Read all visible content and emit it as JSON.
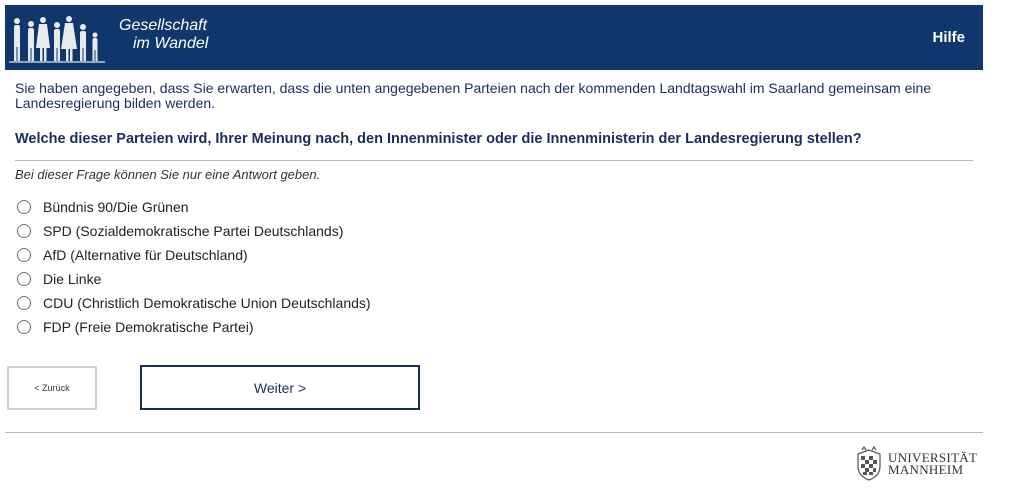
{
  "header": {
    "logo_line1": "Gesellschaft",
    "logo_line2": "im Wandel",
    "help_label": "Hilfe",
    "background_color": "#10376b"
  },
  "intro_text": "Sie haben angegeben, dass Sie erwarten, dass die unten angegebenen Parteien nach der kommenden Landtagswahl im Saarland gemeinsam eine Landesregierung bilden werden.",
  "question": "Welche dieser Parteien wird, Ihrer Meinung nach, den Innenminister oder die Innenministerin der Landesregierung stellen?",
  "instruction": "Bei dieser Frage können Sie nur eine Antwort geben.",
  "options": [
    {
      "label": "Bündnis 90/Die Grünen",
      "selected": false
    },
    {
      "label": "SPD (Sozialdemokratische Partei Deutschlands)",
      "selected": false
    },
    {
      "label": "AfD (Alternative für Deutschland)",
      "selected": false
    },
    {
      "label": "Die Linke",
      "selected": false
    },
    {
      "label": "CDU (Christlich Demokratische Union Deutschlands)",
      "selected": false
    },
    {
      "label": "FDP (Freie Demokratische Partei)",
      "selected": false
    }
  ],
  "navigation": {
    "back_label": "< Zurück",
    "next_label": "Weiter >"
  },
  "footer": {
    "university_line1": "UNIVERSITÄT",
    "university_line2": "MANNHEIM"
  }
}
